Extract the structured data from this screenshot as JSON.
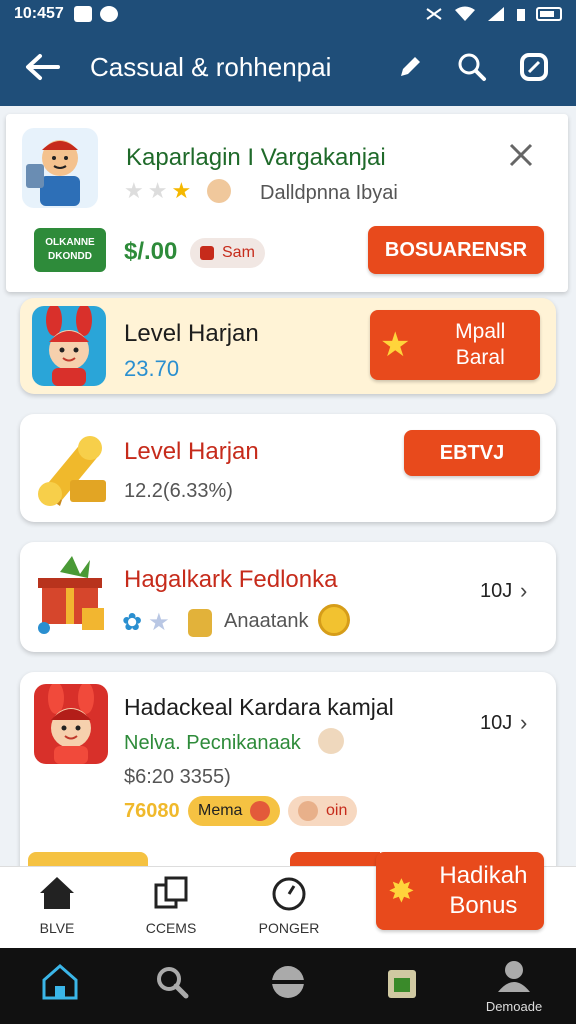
{
  "status_bar": {
    "time": "10:457"
  },
  "app_bar": {
    "title": "Cassual & rohhenpai"
  },
  "cards": {
    "top": {
      "title": "Kaparlagin I Vargakanjai",
      "rating_text": "Dalldpnna Ibyai",
      "badge_line1": "OLKANNE",
      "badge_line2": "DKONDD",
      "price": "$/.00",
      "tag": "Sam",
      "button": "BOSUARENSR"
    },
    "level1": {
      "title": "Level Harjan",
      "value": "23.70",
      "button_line1": "Mpall",
      "button_line2": "Baral"
    },
    "level2": {
      "title": "Level Harjan",
      "value": "12.2(6.33%)",
      "button": "EBTVJ"
    },
    "gift": {
      "title": "Hagalkark Fedlonka",
      "meta": "Anaatank",
      "count": "10J"
    },
    "last": {
      "title": "Hadackeal Kardara kamjal",
      "subtitle": "Nelva. Pecnikanaak",
      "price": "$6:20  3355)",
      "promo": "76080",
      "pill1": "Mema",
      "pill2": "oin",
      "count": "10J"
    }
  },
  "floating_bonus": {
    "line1": "Hadikah",
    "line2": "Bonus"
  },
  "bottom_tabs": [
    {
      "label": "BLVE"
    },
    {
      "label": "CCEMS"
    },
    {
      "label": "PONGER"
    }
  ],
  "nav_bar": {
    "profile_label": "Demoade"
  },
  "colors": {
    "primary": "#1f4e79",
    "accent": "#e84a1c",
    "green": "#2e8b3a"
  }
}
